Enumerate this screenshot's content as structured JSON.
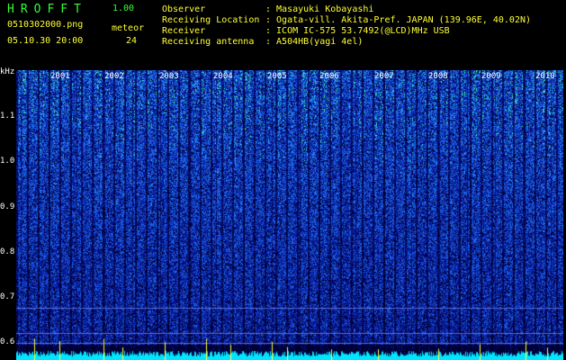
{
  "header": {
    "app_title": "HROFFT",
    "version": "1.00",
    "filename": "0510302000.png",
    "datetime": "05.10.30 20:00",
    "meteor_label": "meteor",
    "meteor_count": "24",
    "info": [
      {
        "label": "Observer",
        "value": ": Masayuki Kobayashi"
      },
      {
        "label": "Receiving Location",
        "value": ": Ogata-vill. Akita-Pref. JAPAN (139.96E, 40.02N)"
      },
      {
        "label": "Receiver",
        "value": ": ICOM IC-575 53.7492(@LCD)MHz USB"
      },
      {
        "label": "Receiving antenna",
        "value": ": A504HB(yagi 4el)"
      }
    ]
  },
  "spectrogram": {
    "freq_unit": "kHz",
    "freq_ticks": [
      "1.1",
      "1.0",
      "0.9",
      "0.8",
      "0.7",
      "0.6"
    ],
    "time_ticks": [
      "2001",
      "2002",
      "2003",
      "2004",
      "2005",
      "2006",
      "2007",
      "2008",
      "2009",
      "2010"
    ],
    "colors": {
      "background": "#000000",
      "noise_dark": "#0b1a8a",
      "noise_mid": "#1f48d8",
      "noise_hot": "#33ffaa",
      "baseline": "#00e5ff",
      "marker": "#ffff33"
    }
  }
}
